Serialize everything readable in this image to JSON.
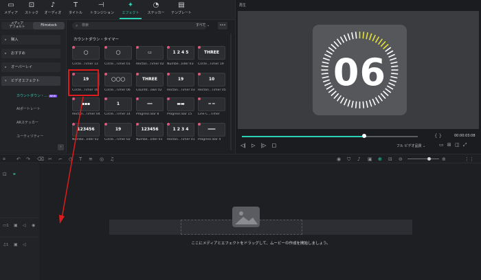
{
  "top_tabs": [
    {
      "icon": "▭",
      "label": "メディア"
    },
    {
      "icon": "⊡",
      "label": "ストック"
    },
    {
      "icon": "♪",
      "label": "オーディオ"
    },
    {
      "icon": "T",
      "label": "タイトル"
    },
    {
      "icon": "⊣",
      "label": "トランジション"
    },
    {
      "icon": "✦",
      "label": "エフェクト"
    },
    {
      "icon": "◔",
      "label": "ステッカー"
    },
    {
      "icon": "▤",
      "label": "テンプレート"
    }
  ],
  "segment": {
    "left": "メディア",
    "sub_left": "デフォルト",
    "right": "Filmstock"
  },
  "search": {
    "placeholder": "検索",
    "filter": "すべて",
    "more": "•••"
  },
  "sidebar": {
    "items": [
      "購入",
      "おすすめ",
      "オーバーレイ",
      "ビデオエフェクト"
    ],
    "subitems": [
      "カウントダウン・…",
      "AIポートレート",
      "ARステッカー",
      "ユーティリティー"
    ],
    "new_badge": "NEW"
  },
  "section_title": "カウントダウン・タイマー",
  "thumbs": [
    {
      "text": "◯",
      "label": "Circle...Timer 13"
    },
    {
      "text": "◯",
      "label": "Circle...Timer 01"
    },
    {
      "text": "▭",
      "label": "Rectan...Timer 02"
    },
    {
      "text": "1 2 4 5",
      "label": "Numbe...Iider 03"
    },
    {
      "text": "THREE",
      "label": "Circle...Timer 19"
    },
    {
      "text": "19",
      "label": "Circle...Timer 16"
    },
    {
      "text": "◯◯◯",
      "label": "Circle...Timer 06"
    },
    {
      "text": "THREE",
      "label": "Countd...own 02"
    },
    {
      "text": "19",
      "label": "Rectan...Timer 03"
    },
    {
      "text": "10",
      "label": "Rectan...Timer 05"
    },
    {
      "text": "▪▪▪",
      "label": "Rectan...Timer 04"
    },
    {
      "text": "1",
      "label": "Circle...Timer 14"
    },
    {
      "text": "━━",
      "label": "Progress Bar 8"
    },
    {
      "text": "▬▬",
      "label": "Progress Bar 15"
    },
    {
      "text": "━ ━",
      "label": "Line C...Timer"
    },
    {
      "text": "123456",
      "label": "Numbe...Iider 02"
    },
    {
      "text": "19",
      "label": "Circle...Timer 02"
    },
    {
      "text": "123456",
      "label": "Numbe...Iider 01"
    },
    {
      "text": "1 2 3 4",
      "label": "Rectan...Timer 01"
    },
    {
      "text": "═══",
      "label": "Progress Bar 4"
    }
  ],
  "preview": {
    "label": "再生",
    "big_number": "06",
    "timecode": "00:00:03:08",
    "quality": "フル ビデオ品質"
  },
  "timeline": {
    "drop_hint": "ここにメディアとエフェクトをドラッグして、ムービーの作成を開始しましょう。"
  },
  "colors": {
    "accent": "#2ad3b5",
    "highlight": "#e01b1b",
    "yellow": "#e6e33a"
  }
}
